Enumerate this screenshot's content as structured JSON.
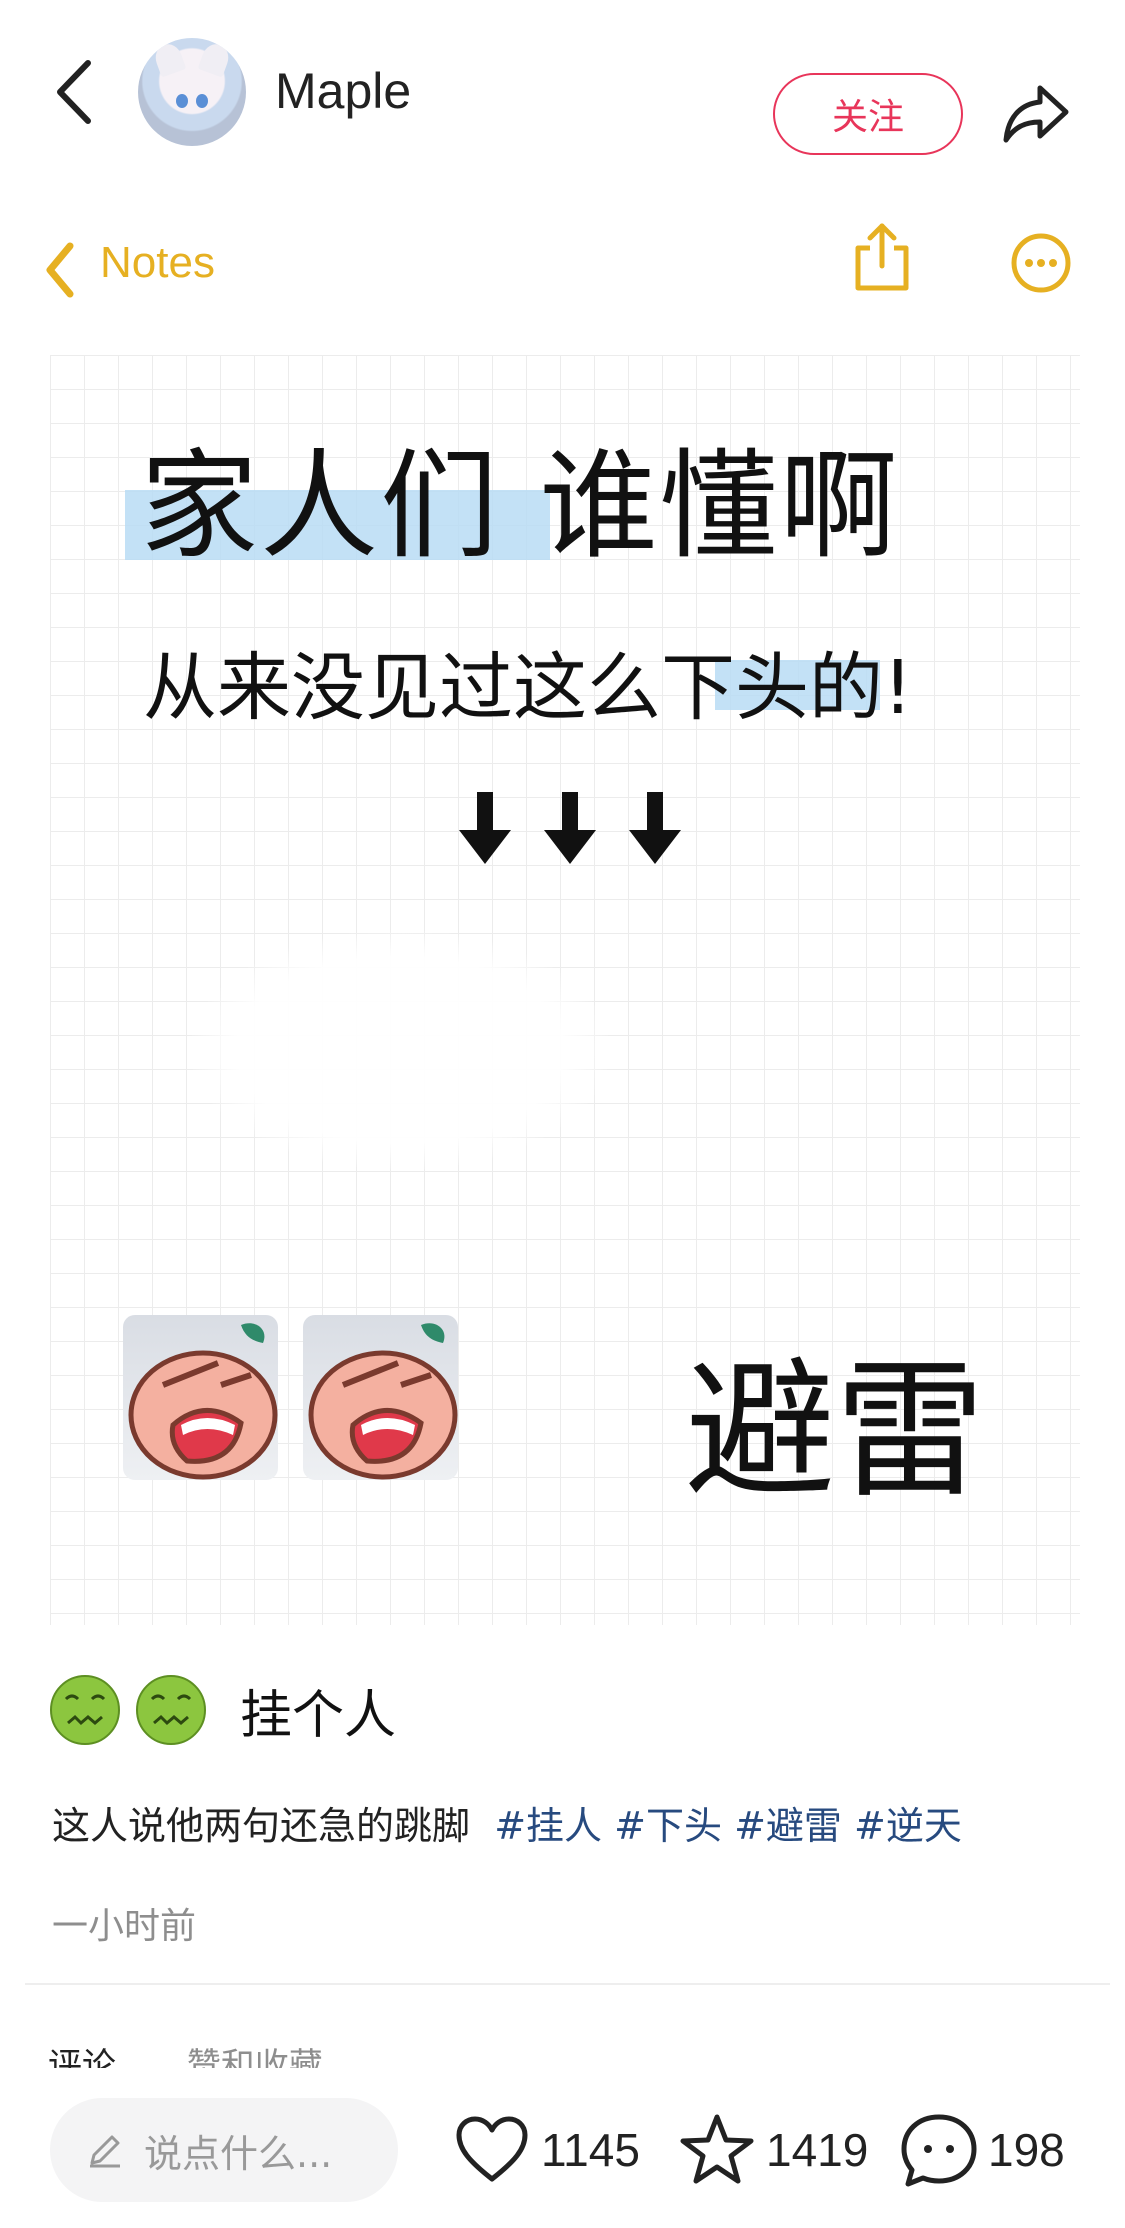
{
  "header": {
    "username": "Maple",
    "follow_label": "关注"
  },
  "embedded_notes": {
    "back_label": "Notes",
    "headline": "家人们 谁懂啊",
    "subline": "从来没见过这么下头的!",
    "sticker_caption": "避雷"
  },
  "post": {
    "title": "挂个人",
    "body": "这人说他两句还急的跳脚",
    "tags": [
      "#挂人",
      "#下头",
      "#避雷",
      "#逆天"
    ],
    "time": "一小时前"
  },
  "tabs": [
    "评论",
    "赞和收藏"
  ],
  "bottom_bar": {
    "comment_placeholder": "说点什么...",
    "likes": "1145",
    "favorites": "1419",
    "comments": "198"
  },
  "colors": {
    "accent_red": "#e8355a",
    "notes_yellow": "#e6b022",
    "tag_blue": "#274a7f",
    "highlight_blue": "#b8dcf5"
  },
  "icons": [
    "back-chevron-icon",
    "share-arrow-icon",
    "notes-back-chevron-icon",
    "notes-share-icon",
    "more-options-icon",
    "down-arrow-icon",
    "sick-face-icon",
    "pencil-icon",
    "heart-icon",
    "star-icon",
    "comment-bubble-icon"
  ]
}
